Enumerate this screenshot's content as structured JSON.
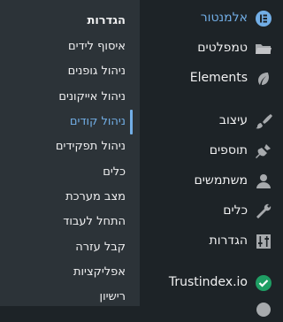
{
  "submenu": {
    "items": [
      {
        "label": "הגדרות",
        "type": "head"
      },
      {
        "label": "איסוף לידים"
      },
      {
        "label": "ניהול גופנים"
      },
      {
        "label": "ניהול אייקונים"
      },
      {
        "label": "ניהול קודים",
        "current": true
      },
      {
        "label": "ניהול תפקידים"
      },
      {
        "label": "כלים"
      },
      {
        "label": "מצב מערכת"
      },
      {
        "label": "התחל לעבוד"
      },
      {
        "label": "קבל עזרה"
      },
      {
        "label": "אפליקציות"
      },
      {
        "label": "רישיון"
      }
    ]
  },
  "menu": {
    "items": [
      {
        "label": "אלמנטור",
        "icon": "elementor-icon",
        "active": true
      },
      {
        "label": "טמפלטים",
        "icon": "folder-icon"
      },
      {
        "label": "Elements",
        "icon": "leaf-icon"
      },
      {
        "label": "עיצוב",
        "icon": "paintbrush-icon"
      },
      {
        "label": "תוספים",
        "icon": "plugin-icon"
      },
      {
        "label": "משתמשים",
        "icon": "user-icon"
      },
      {
        "label": "כלים",
        "icon": "wrench-icon"
      },
      {
        "label": "הגדרות",
        "icon": "settings-sliders-icon"
      },
      {
        "label": "Trustindex.io",
        "icon": "check-circle-icon"
      }
    ]
  },
  "colors": {
    "menu_bg": "#1d2327",
    "submenu_bg": "#2c3338",
    "accent": "#72aee6",
    "trust_green": "#1f9e64"
  }
}
